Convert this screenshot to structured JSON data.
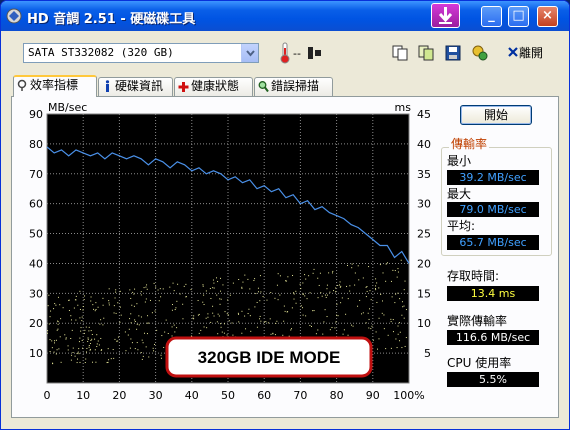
{
  "window": {
    "title": "HD 音調 2.51 - 硬磁碟工具",
    "buttons": {
      "minimize": "_",
      "maximize": "□",
      "close": "×"
    }
  },
  "toolbar": {
    "drive": "SATA  ST332082 (320 GB)",
    "temperature": "--",
    "exit_label": "離開"
  },
  "tabs": [
    {
      "label": "效率指標",
      "icon": "benchmark-icon"
    },
    {
      "label": "硬碟資訊",
      "icon": "info-icon"
    },
    {
      "label": "健康狀態",
      "icon": "health-icon"
    },
    {
      "label": "錯誤掃描",
      "icon": "error-scan-icon"
    }
  ],
  "side": {
    "start_label": "開始",
    "transfer_rate_title": "傳輸率",
    "min_label": "最小",
    "min_value": "39.2 MB/sec",
    "max_label": "最大",
    "max_value": "79.0 MB/sec",
    "avg_label": "平均:",
    "avg_value": "65.7 MB/sec",
    "access_label": "存取時間:",
    "access_value": "13.4 ms",
    "burst_label": "實際傳輸率",
    "burst_value": "116.6 MB/sec",
    "cpu_label": "CPU 使用率",
    "cpu_value": "5.5%"
  },
  "chart_data": {
    "type": "line",
    "left_unit": "MB/sec",
    "right_unit": "ms",
    "left_ticks": [
      "90",
      "80",
      "70",
      "60",
      "50",
      "40",
      "30",
      "20",
      "10"
    ],
    "right_ticks": [
      "45",
      "40",
      "35",
      "30",
      "25",
      "20",
      "15",
      "10",
      "5"
    ],
    "x_ticks": [
      "0",
      "10",
      "20",
      "30",
      "40",
      "50",
      "60",
      "70",
      "80",
      "90",
      "100%"
    ],
    "ylim_left": [
      0,
      90
    ],
    "ylim_right": [
      0,
      45
    ],
    "xlim": [
      0,
      100
    ],
    "grid": true,
    "overlay_label": "320GB IDE MODE",
    "transfer_series": {
      "name": "",
      "x": [
        0,
        2,
        4,
        6,
        8,
        10,
        12,
        14,
        16,
        18,
        20,
        22,
        24,
        26,
        28,
        30,
        32,
        34,
        36,
        38,
        40,
        42,
        44,
        46,
        48,
        50,
        52,
        54,
        56,
        58,
        60,
        62,
        64,
        66,
        68,
        70,
        72,
        74,
        76,
        78,
        80,
        82,
        84,
        86,
        88,
        90,
        92,
        94,
        96,
        98,
        100
      ],
      "y": [
        79,
        77,
        78,
        76,
        78,
        77,
        76,
        77,
        75,
        77,
        76,
        75,
        76,
        75,
        73,
        75,
        74,
        72,
        74,
        73,
        71,
        72,
        70,
        71,
        70,
        68,
        69,
        67,
        68,
        65,
        66,
        64,
        65,
        62,
        63,
        60,
        61,
        58,
        59,
        57,
        56,
        55,
        53,
        52,
        50,
        48,
        46,
        46,
        42,
        44,
        40
      ]
    },
    "access_series": {
      "name": "",
      "x_range": [
        0,
        100
      ],
      "ms_min_start": 3,
      "ms_max_start": 15,
      "ms_min_end": 6,
      "ms_max_end": 21
    }
  }
}
